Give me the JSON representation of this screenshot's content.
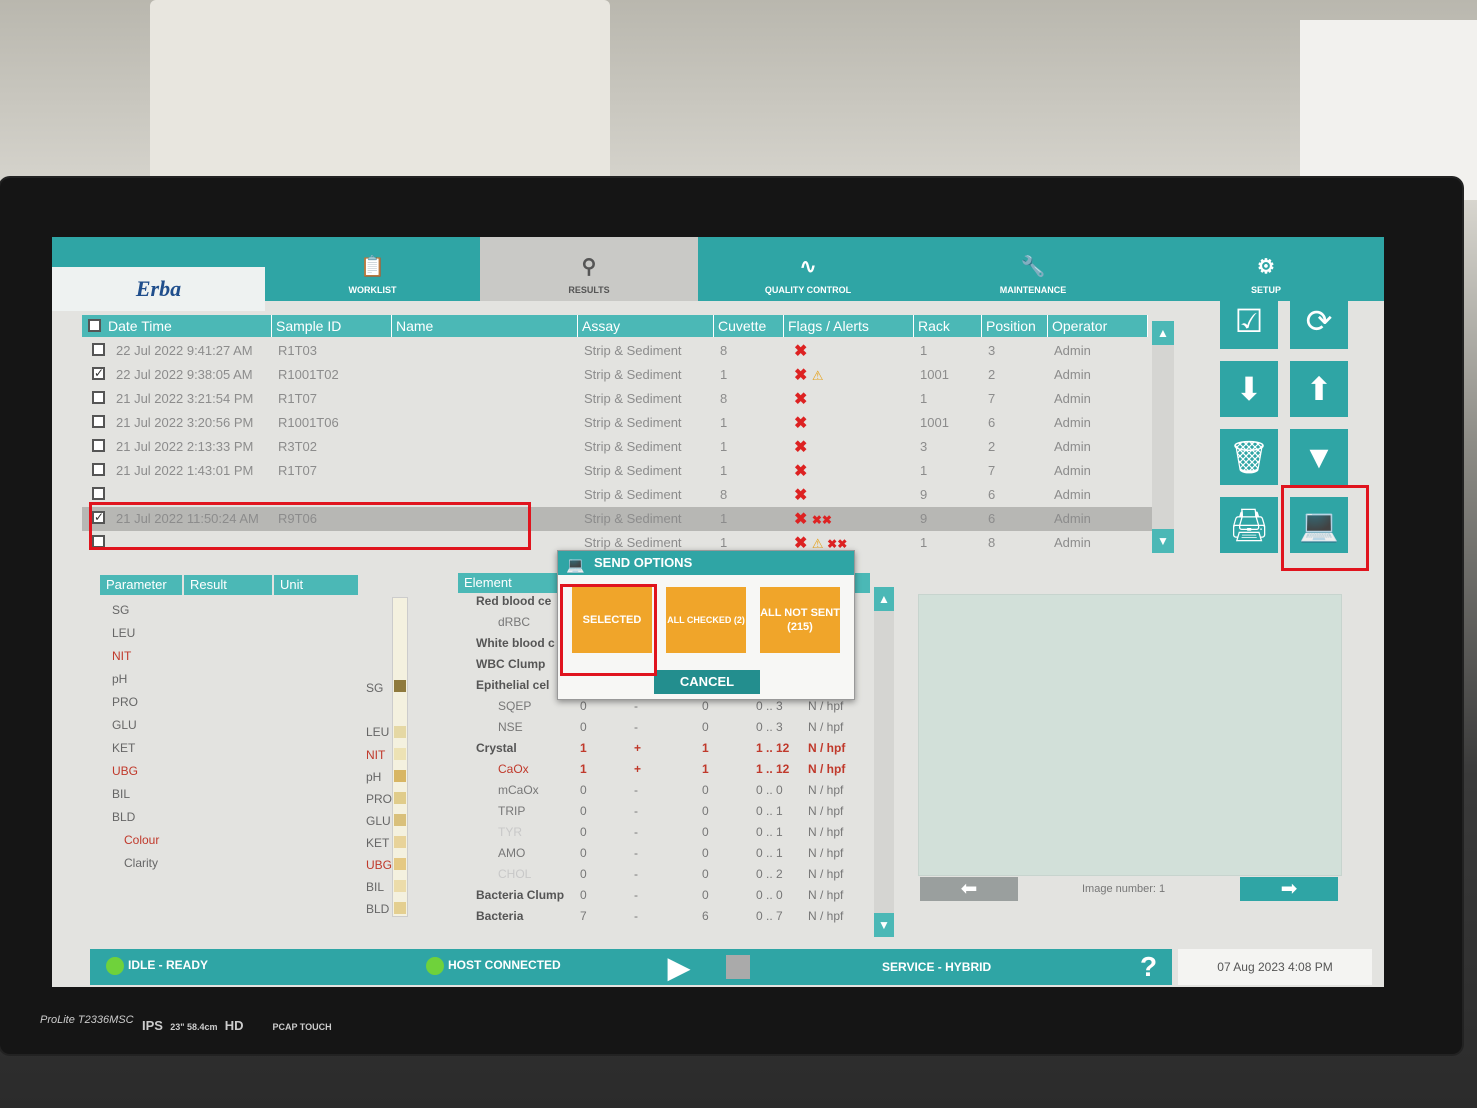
{
  "app": {
    "logo": "Erba"
  },
  "nav": [
    {
      "label": "WORKLIST",
      "icon": "clipboard-icon"
    },
    {
      "label": "RESULTS",
      "icon": "microscope-icon"
    },
    {
      "label": "QUALITY CONTROL",
      "icon": "qc-chart-icon"
    },
    {
      "label": "MAINTENANCE",
      "icon": "wrench-icon"
    },
    {
      "label": "SETUP",
      "icon": "gear-icon"
    }
  ],
  "results_table": {
    "headers": [
      "Date Time",
      "Sample ID",
      "Name",
      "Assay",
      "Cuvette",
      "Flags / Alerts",
      "Rack",
      "Position",
      "Operator"
    ],
    "rows": [
      {
        "date": "22 Jul 2022 9:41:27 AM",
        "sample": "R1T03",
        "name": "",
        "assay": "Strip & Sediment",
        "cuvette": "8",
        "rack": "1",
        "position": "3",
        "operator": "Admin",
        "checked": false
      },
      {
        "date": "22 Jul 2022 9:38:05 AM",
        "sample": "R1001T02",
        "name": "",
        "assay": "Strip & Sediment",
        "cuvette": "1",
        "rack": "1001",
        "position": "2",
        "operator": "Admin",
        "checked": true
      },
      {
        "date": "21 Jul 2022 3:21:54 PM",
        "sample": "R1T07",
        "name": "",
        "assay": "Strip & Sediment",
        "cuvette": "8",
        "rack": "1",
        "position": "7",
        "operator": "Admin",
        "checked": false
      },
      {
        "date": "21 Jul 2022 3:20:56 PM",
        "sample": "R1001T06",
        "name": "",
        "assay": "Strip & Sediment",
        "cuvette": "1",
        "rack": "1001",
        "position": "6",
        "operator": "Admin",
        "checked": false
      },
      {
        "date": "21 Jul 2022 2:13:33 PM",
        "sample": "R3T02",
        "name": "",
        "assay": "Strip & Sediment",
        "cuvette": "1",
        "rack": "3",
        "position": "2",
        "operator": "Admin",
        "checked": false
      },
      {
        "date": "21 Jul 2022 1:43:01 PM",
        "sample": "R1T07",
        "name": "",
        "assay": "Strip & Sediment",
        "cuvette": "1",
        "rack": "1",
        "position": "7",
        "operator": "Admin",
        "checked": false
      },
      {
        "date": "",
        "sample": "",
        "name": "",
        "assay": "Strip & Sediment",
        "cuvette": "8",
        "rack": "9",
        "position": "6",
        "operator": "Admin",
        "checked": false
      },
      {
        "date": "21 Jul 2022 11:50:24 AM",
        "sample": "R9T06",
        "name": "",
        "assay": "Strip & Sediment",
        "cuvette": "1",
        "rack": "9",
        "position": "6",
        "operator": "Admin",
        "checked": true
      },
      {
        "date": "",
        "sample": "",
        "name": "",
        "assay": "Strip & Sediment",
        "cuvette": "1",
        "rack": "1",
        "position": "8",
        "operator": "Admin",
        "checked": false
      }
    ]
  },
  "parameters": {
    "headers": [
      "Parameter",
      "Result",
      "Unit"
    ],
    "items": [
      "SG",
      "LEU",
      "NIT",
      "pH",
      "PRO",
      "GLU",
      "KET",
      "UBG",
      "BIL",
      "BLD",
      "Colour",
      "Clarity"
    ]
  },
  "strip_labels": [
    "SG",
    "LEU",
    "NIT",
    "pH",
    "PRO",
    "GLU",
    "KET",
    "UBG",
    "BIL",
    "BLD"
  ],
  "elements": {
    "header": "Element",
    "rows": [
      {
        "name": "Red blood ce",
        "v1": "",
        "v2": "",
        "v3": "",
        "range": "",
        "unit": ""
      },
      {
        "name": "dRBC",
        "v1": "",
        "v2": "",
        "v3": "",
        "range": "",
        "unit": ""
      },
      {
        "name": "White blood c",
        "v1": "",
        "v2": "",
        "v3": "",
        "range": "",
        "unit": ""
      },
      {
        "name": "WBC Clump",
        "v1": "",
        "v2": "",
        "v3": "",
        "range": "",
        "unit": ""
      },
      {
        "name": "Epithelial cel",
        "v1": "",
        "v2": "",
        "v3": "",
        "range": "",
        "unit": ""
      },
      {
        "name": "SQEP",
        "v1": "0",
        "v2": "-",
        "v3": "0",
        "range": "0 .. 3",
        "unit": "N / hpf"
      },
      {
        "name": "NSE",
        "v1": "0",
        "v2": "-",
        "v3": "0",
        "range": "0 .. 3",
        "unit": "N / hpf"
      },
      {
        "name": "Crystal",
        "v1": "1",
        "v2": "+",
        "v3": "1",
        "range": "1 .. 12",
        "unit": "N / hpf"
      },
      {
        "name": "CaOx",
        "v1": "1",
        "v2": "+",
        "v3": "1",
        "range": "1 .. 12",
        "unit": "N / hpf"
      },
      {
        "name": "mCaOx",
        "v1": "0",
        "v2": "-",
        "v3": "0",
        "range": "0 .. 0",
        "unit": "N / hpf"
      },
      {
        "name": "TRIP",
        "v1": "0",
        "v2": "-",
        "v3": "0",
        "range": "0 .. 1",
        "unit": "N / hpf"
      },
      {
        "name": "TYR",
        "v1": "0",
        "v2": "-",
        "v3": "0",
        "range": "0 .. 1",
        "unit": "N / hpf"
      },
      {
        "name": "AMO",
        "v1": "0",
        "v2": "-",
        "v3": "0",
        "range": "0 .. 1",
        "unit": "N / hpf"
      },
      {
        "name": "CHOL",
        "v1": "0",
        "v2": "-",
        "v3": "0",
        "range": "0 .. 2",
        "unit": "N / hpf"
      },
      {
        "name": "Bacteria Clump",
        "v1": "0",
        "v2": "-",
        "v3": "0",
        "range": "0 .. 0",
        "unit": "N / hpf"
      },
      {
        "name": "Bacteria",
        "v1": "7",
        "v2": "-",
        "v3": "6",
        "range": "0 .. 7",
        "unit": "N / hpf"
      }
    ]
  },
  "image_panel": {
    "image_number_label": "Image number: 1"
  },
  "dialog": {
    "title": "SEND OPTIONS",
    "selected": "SELECTED",
    "all_checked": "ALL CHECKED (2)",
    "all_not_sent": "ALL NOT SENT (215)",
    "cancel": "CANCEL"
  },
  "status": {
    "idle": "IDLE - READY",
    "host": "HOST CONNECTED",
    "service": "SERVICE - HYBRID",
    "help": "?",
    "datetime": "07 Aug 2023   4:08 PM"
  },
  "monitor": {
    "model": "ProLite T2336MSC",
    "ips": "IPS",
    "size": "23\" 58.4cm",
    "hd": "HD",
    "pcap": "PCAP TOUCH"
  }
}
